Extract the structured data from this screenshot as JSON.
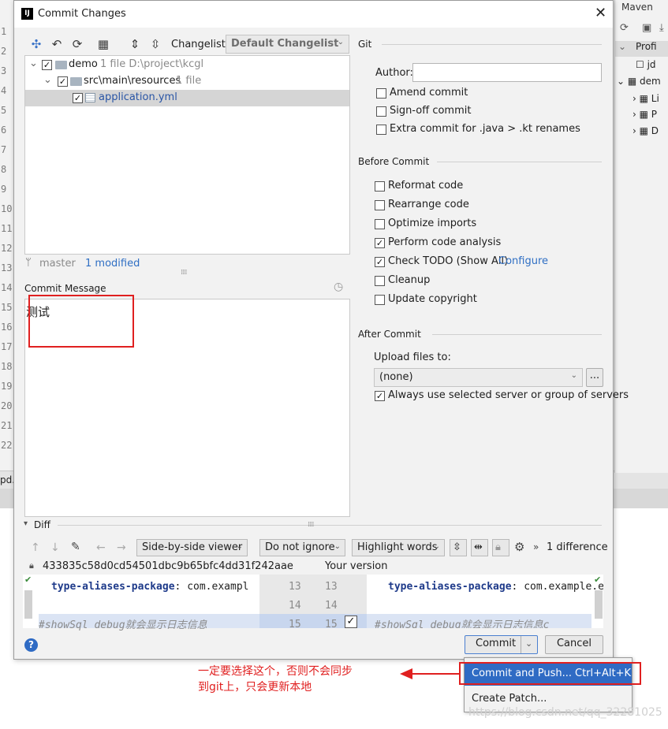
{
  "background": {
    "gutter_numbers": [
      "1",
      "2",
      "3",
      "4",
      "5",
      "6",
      "7",
      "8",
      "9",
      "10",
      "11",
      "12",
      "13",
      "14",
      "15",
      "16",
      "17",
      "18",
      "19",
      "20",
      "21",
      "22"
    ],
    "maven": {
      "title": "Maven",
      "rows": [
        "Profi",
        "jd",
        "dem",
        "Li",
        "P",
        "D"
      ]
    },
    "left_tab": "pd."
  },
  "dialog": {
    "title": "Commit Changes",
    "changelist_label": "Changelist:",
    "changelist_value": "Default Changelist",
    "tree": [
      {
        "name": "demo",
        "meta": "1 file  D:\\project\\kcgl",
        "checked": true
      },
      {
        "name": "src\\main\\resources",
        "meta": "1 file",
        "checked": true
      },
      {
        "name": "application.yml",
        "meta": "",
        "checked": true
      }
    ],
    "branch": "master",
    "modified": "1 modified",
    "commit_message_label": "Commit Message",
    "commit_message": "测试",
    "git": {
      "section": "Git",
      "author_label": "Author:",
      "author_value": "",
      "options": [
        {
          "label": "Amend commit",
          "checked": false
        },
        {
          "label": "Sign-off commit",
          "checked": false
        },
        {
          "label": "Extra commit for .java > .kt renames",
          "checked": false
        }
      ]
    },
    "before_commit": {
      "section": "Before Commit",
      "options": [
        {
          "label": "Reformat code",
          "checked": false
        },
        {
          "label": "Rearrange code",
          "checked": false
        },
        {
          "label": "Optimize imports",
          "checked": false
        },
        {
          "label": "Perform code analysis",
          "checked": true
        },
        {
          "label": "Check TODO (Show All)",
          "checked": true,
          "link": "Configure"
        },
        {
          "label": "Cleanup",
          "checked": false
        },
        {
          "label": "Update copyright",
          "checked": false
        }
      ]
    },
    "after_commit": {
      "section": "After Commit",
      "upload_label": "Upload files to:",
      "upload_value": "(none)",
      "more_button": "...",
      "always_use": "Always use selected server or group of servers",
      "always_use_checked": true
    },
    "diff": {
      "section": "Diff",
      "viewer": "Side-by-side viewer",
      "ignore": "Do not ignore",
      "highlight": "Highlight words",
      "difference_count": "1 difference",
      "hash": "433835c58d0cd54501dbc9b65bfc4dd31f242aae",
      "your_version": "Your version",
      "left_lines": [
        {
          "kw": "type-aliases-package",
          "rest": ": com.exampl"
        },
        {
          "kw": "",
          "rest": ""
        },
        {
          "kw": "",
          "rest": "#showSql debug就会显示日志信息"
        }
      ],
      "right_lines": [
        {
          "kw": "type-aliases-package",
          "rest": ": com.example.e"
        },
        {
          "kw": "",
          "rest": ""
        },
        {
          "kw": "",
          "rest": "#showSql debug就会显示日志信息c"
        }
      ],
      "numbers_left": [
        "13",
        "14",
        "15"
      ],
      "numbers_right": [
        "13",
        "14",
        "15"
      ]
    },
    "buttons": {
      "commit": "Commit",
      "cancel": "Cancel"
    },
    "popup": {
      "commit_and_push": "Commit and Push...",
      "shortcut": "Ctrl+Alt+K",
      "create_patch": "Create Patch..."
    }
  },
  "annotation": {
    "line1": "一定要选择这个，否则不会同步",
    "line2": "到git上，只会更新本地"
  },
  "watermark": "https://blog.csdn.net/qq_32281025",
  "colors": {
    "accent": "#2f6bc4",
    "annotation": "#e02020",
    "selection": "#d5d5d5"
  }
}
